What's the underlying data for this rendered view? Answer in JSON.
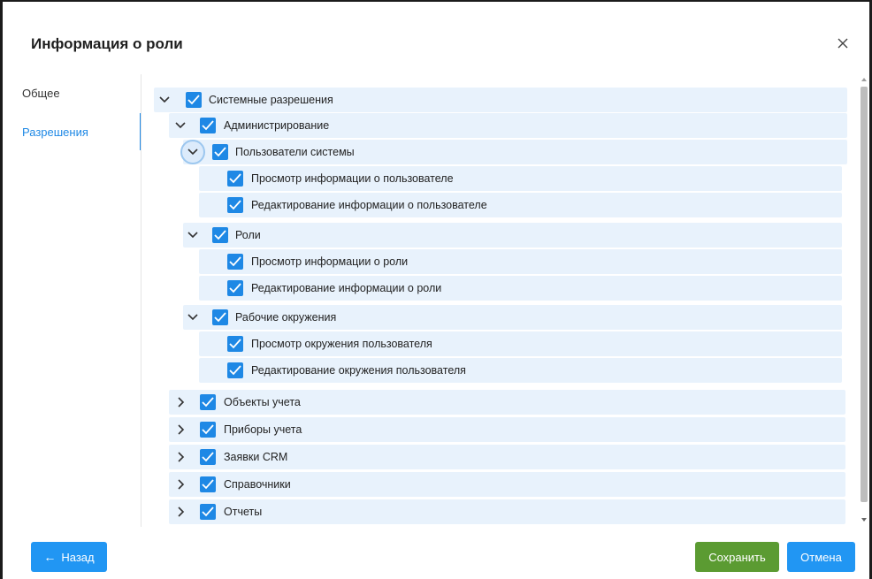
{
  "dialog": {
    "title": "Информация о роли"
  },
  "nav": {
    "general": "Общее",
    "permissions": "Разрешения",
    "active": "permissions"
  },
  "tree": {
    "root": {
      "label": "Системные разрешения",
      "checked": true,
      "expanded": true
    },
    "admin": {
      "label": "Администрирование",
      "checked": true,
      "expanded": true
    },
    "users": {
      "label": "Пользователи системы",
      "checked": true,
      "expanded": true
    },
    "users_view": {
      "label": "Просмотр информации о пользователе",
      "checked": true
    },
    "users_edit": {
      "label": "Редактирование информации о пользователе",
      "checked": true
    },
    "roles": {
      "label": "Роли",
      "checked": true,
      "expanded": true
    },
    "roles_view": {
      "label": "Просмотр информации о роли",
      "checked": true
    },
    "roles_edit": {
      "label": "Редактирование информации о роли",
      "checked": true
    },
    "envs": {
      "label": "Рабочие окружения",
      "checked": true,
      "expanded": true
    },
    "envs_view": {
      "label": "Просмотр окружения пользователя",
      "checked": true
    },
    "envs_edit": {
      "label": "Редактирование окружения пользователя",
      "checked": true
    },
    "objects": {
      "label": "Объекты учета",
      "checked": true,
      "expanded": false
    },
    "devices": {
      "label": "Приборы учета",
      "checked": true,
      "expanded": false
    },
    "crm": {
      "label": "Заявки CRM",
      "checked": true,
      "expanded": false
    },
    "refs": {
      "label": "Справочники",
      "checked": true,
      "expanded": false
    },
    "reports": {
      "label": "Отчеты",
      "checked": true,
      "expanded": false
    }
  },
  "buttons": {
    "back": "Назад",
    "save": "Сохранить",
    "cancel": "Отмена"
  },
  "colors": {
    "accent": "#2196f3",
    "save": "#5b9b32",
    "row_bg": "#e8f2fc",
    "checkbox": "#1e88e5"
  }
}
